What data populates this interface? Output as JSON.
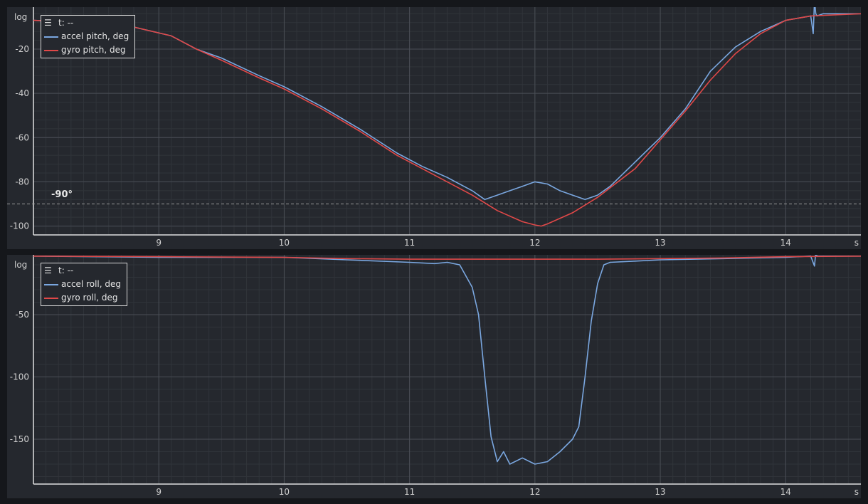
{
  "colors": {
    "background": "#25282e",
    "grid_major": "#4a4e56",
    "grid_minor": "#30343a",
    "accel": "#7aa7e0",
    "gyro": "#e04848",
    "text": "#d0d0d0"
  },
  "chart_data": [
    {
      "type": "line",
      "ylabel": "log",
      "xlabel": "s",
      "xlim": [
        8,
        14.6
      ],
      "ylim": [
        -104,
        -1
      ],
      "x_ticks": [
        9,
        10,
        11,
        12,
        13,
        14
      ],
      "y_ticks": [
        -20,
        -40,
        -60,
        -80,
        -100
      ],
      "grid": true,
      "legend_placement": "top-left",
      "legend_header": "t: --",
      "annotation": {
        "text": "-90°",
        "y": -90,
        "style": "dashed horizontal line"
      },
      "series": [
        {
          "name": "accel pitch, deg",
          "color": "#7aa7e0",
          "x": [
            8.0,
            8.4,
            8.8,
            9.1,
            9.3,
            9.5,
            9.8,
            10.0,
            10.3,
            10.6,
            10.9,
            11.1,
            11.3,
            11.5,
            11.6,
            11.7,
            11.8,
            11.9,
            12.0,
            12.1,
            12.2,
            12.3,
            12.4,
            12.5,
            12.6,
            12.8,
            13.0,
            13.2,
            13.4,
            13.6,
            13.8,
            14.0,
            14.2,
            14.22,
            14.23,
            14.24,
            14.25,
            14.3,
            14.6
          ],
          "y": [
            -7,
            -8,
            -10,
            -14,
            -20,
            -24,
            -32,
            -37,
            -46,
            -56,
            -67,
            -73,
            -78,
            -84,
            -88,
            -86,
            -84,
            -82,
            -80,
            -81,
            -84,
            -86,
            -88,
            -86,
            -82,
            -71,
            -60,
            -47,
            -30,
            -19,
            -12,
            -7,
            -5,
            -13,
            2,
            -4,
            -5,
            -4,
            -4
          ]
        },
        {
          "name": "gyro pitch, deg",
          "color": "#e04848",
          "x": [
            8.0,
            8.4,
            8.8,
            9.1,
            9.3,
            9.5,
            9.8,
            10.0,
            10.3,
            10.6,
            10.9,
            11.1,
            11.3,
            11.5,
            11.7,
            11.9,
            12.0,
            12.05,
            12.1,
            12.3,
            12.5,
            12.8,
            13.0,
            13.2,
            13.4,
            13.6,
            13.8,
            14.0,
            14.2,
            14.6
          ],
          "y": [
            -7,
            -8,
            -10,
            -14,
            -20,
            -25,
            -33,
            -38,
            -47,
            -57,
            -68,
            -74,
            -80,
            -86,
            -93,
            -98,
            -99.5,
            -100,
            -99,
            -94,
            -87,
            -74,
            -61,
            -48,
            -34,
            -22,
            -13,
            -7,
            -5,
            -4
          ]
        }
      ]
    },
    {
      "type": "line",
      "ylabel": "log",
      "xlabel": "s",
      "xlim": [
        8,
        14.6
      ],
      "ylim": [
        -186,
        -2
      ],
      "x_ticks": [
        9,
        10,
        11,
        12,
        13,
        14
      ],
      "y_ticks": [
        -50,
        -100,
        -150
      ],
      "grid": true,
      "legend_placement": "top-left",
      "legend_header": "t: --",
      "series": [
        {
          "name": "accel roll, deg",
          "color": "#7aa7e0",
          "x": [
            8.0,
            9.0,
            10.0,
            10.5,
            11.0,
            11.2,
            11.3,
            11.4,
            11.5,
            11.55,
            11.6,
            11.65,
            11.7,
            11.75,
            11.8,
            11.9,
            12.0,
            12.1,
            12.2,
            12.3,
            12.35,
            12.4,
            12.45,
            12.5,
            12.55,
            12.6,
            12.8,
            13.0,
            13.5,
            14.0,
            14.2,
            14.23,
            14.24,
            14.25,
            14.3,
            14.6
          ],
          "y": [
            -3,
            -4,
            -4,
            -6,
            -8,
            -9,
            -8,
            -10,
            -28,
            -50,
            -100,
            -148,
            -168,
            -160,
            -170,
            -165,
            -170,
            -168,
            -160,
            -150,
            -140,
            -100,
            -55,
            -25,
            -10,
            -8,
            -7,
            -6,
            -5,
            -4,
            -3,
            -11,
            0,
            -3,
            -3,
            -3
          ]
        },
        {
          "name": "gyro roll, deg",
          "color": "#e04848",
          "x": [
            8.0,
            9.0,
            10.0,
            10.5,
            11.0,
            11.5,
            12.0,
            12.5,
            13.0,
            13.5,
            14.0,
            14.6
          ],
          "y": [
            -3,
            -3.5,
            -4,
            -5,
            -5.5,
            -5.5,
            -5.5,
            -5.5,
            -5,
            -4.5,
            -3.5,
            -3
          ]
        }
      ]
    }
  ]
}
